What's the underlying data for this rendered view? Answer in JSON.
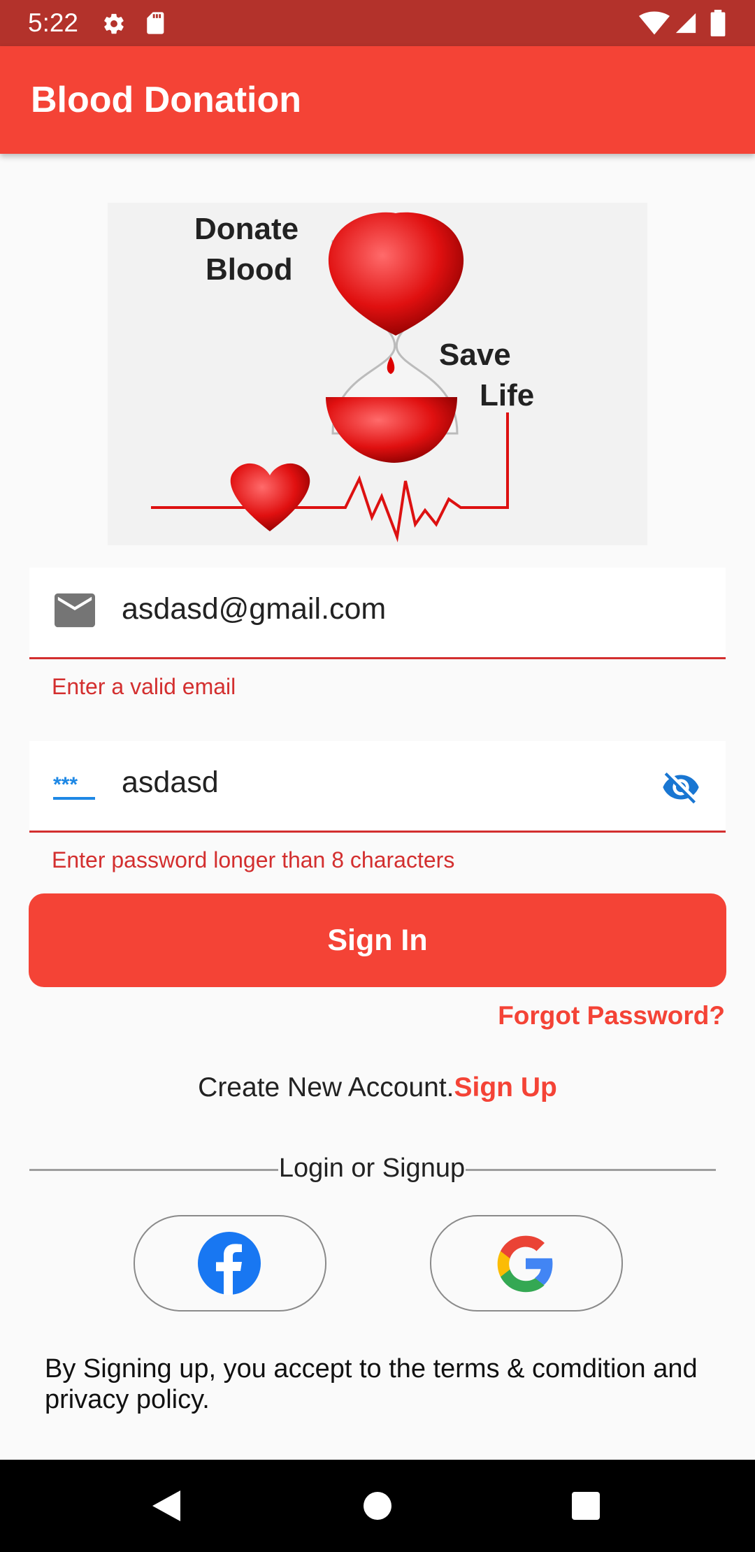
{
  "status_bar": {
    "time": "5:22"
  },
  "app_bar": {
    "title": "Blood Donation"
  },
  "banner": {
    "word_1": "Donate",
    "word_2": "Blood",
    "word_3": "Save",
    "word_4": "Life"
  },
  "email_field": {
    "value": "asdasd@gmail.com",
    "error": "Enter a valid email",
    "icon": "email-icon"
  },
  "password_field": {
    "value": "asdasd",
    "error": "Enter password longer than 8 characters",
    "icon": "password-icon",
    "toggle_icon": "visibility-off-icon"
  },
  "buttons": {
    "sign_in": "Sign In",
    "forgot_password": "Forgot Password?",
    "create_account_text": "Create New Account.",
    "sign_up": "Sign Up"
  },
  "divider": {
    "label": "Login or Signup"
  },
  "social": {
    "facebook": "facebook-icon",
    "google": "google-icon"
  },
  "terms": "By Signing up, you accept to the terms & comdition and privacy policy.",
  "colors": {
    "primary": "#f44336",
    "status_bar": "#b3322b",
    "error": "#d32f2f",
    "accent_blue": "#1976d2"
  }
}
